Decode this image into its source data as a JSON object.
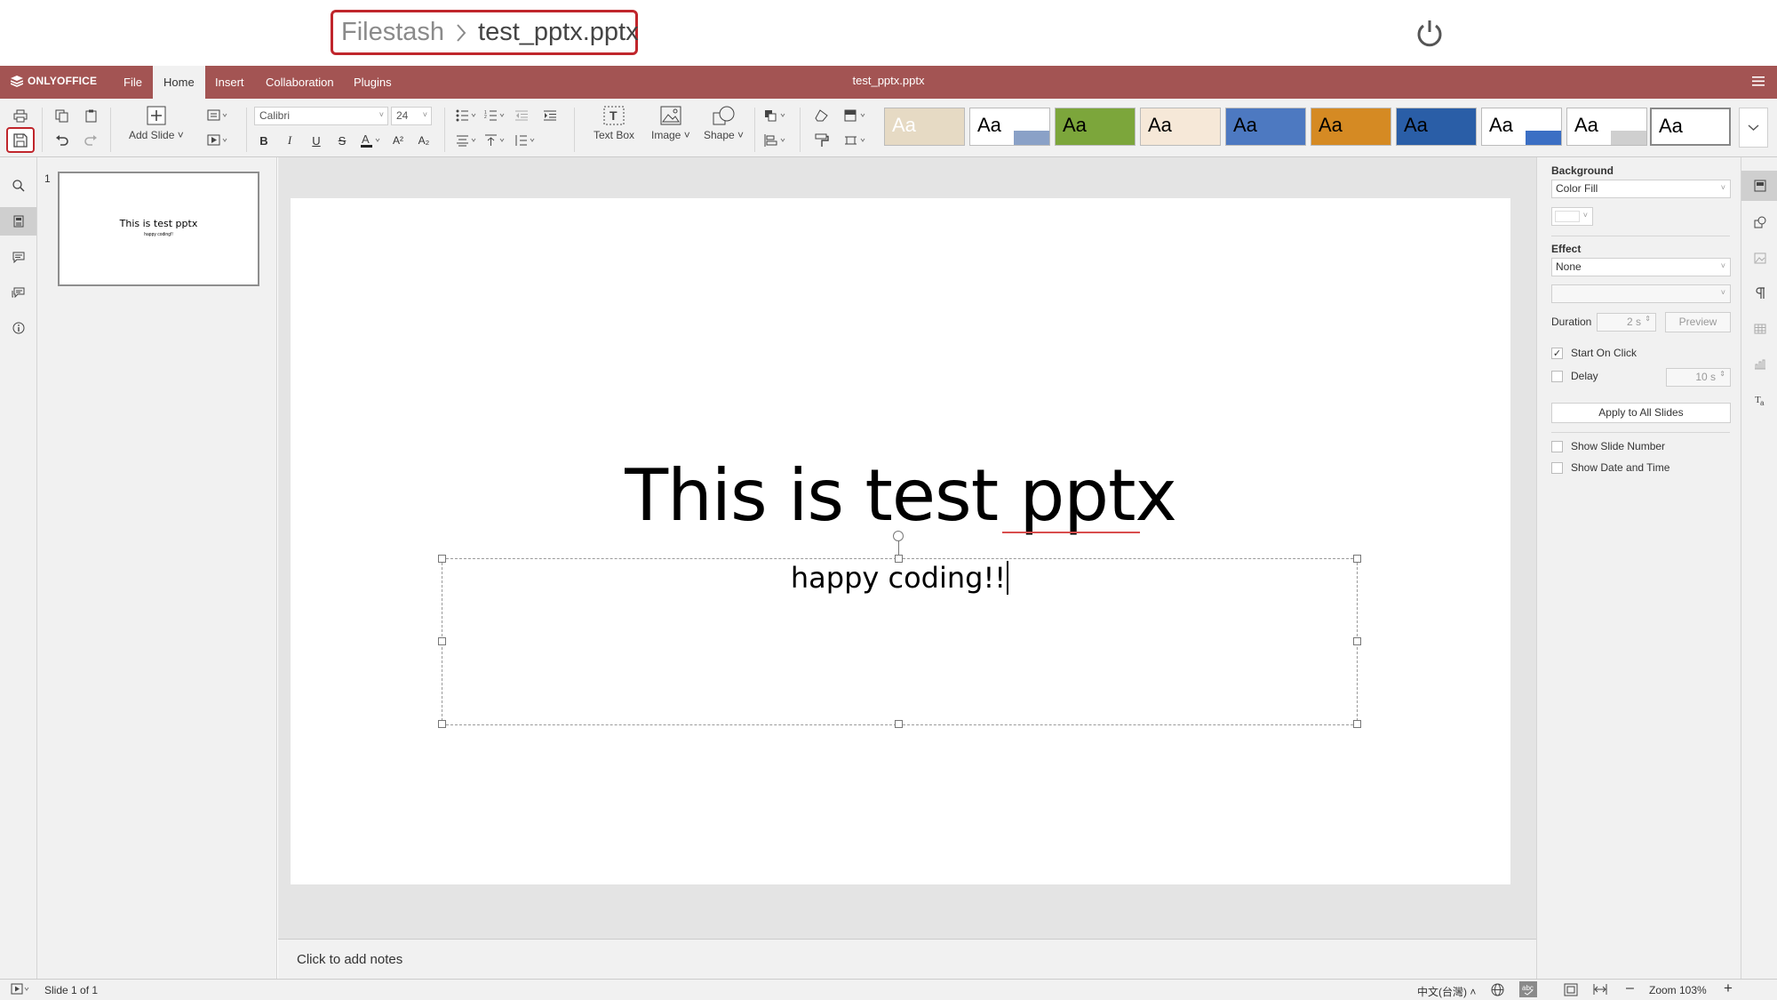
{
  "breadcrumb": {
    "root": "Filestash",
    "file": "test_pptx.pptx"
  },
  "header": {
    "logo": "ONLYOFFICE",
    "doc_title": "test_pptx.pptx",
    "tabs": [
      {
        "label": "File"
      },
      {
        "label": "Home",
        "active": true
      },
      {
        "label": "Insert"
      },
      {
        "label": "Collaboration"
      },
      {
        "label": "Plugins"
      }
    ]
  },
  "toolbar": {
    "add_slide": "Add Slide",
    "font_name": "Calibri",
    "font_size": "24",
    "text_box": "Text Box",
    "image": "Image",
    "shape": "Shape",
    "themes": [
      {
        "name": "theme-1",
        "bg": "#e6dac4",
        "fg": "#fff"
      },
      {
        "name": "theme-2",
        "bg": "#ffffff",
        "accent": "#8aa1c7",
        "fg": "#000"
      },
      {
        "name": "theme-3",
        "bg": "#7ca63b",
        "fg": "#000"
      },
      {
        "name": "theme-4",
        "bg": "#f6e8d8",
        "fg": "#000"
      },
      {
        "name": "theme-5",
        "bg": "#4d79c1",
        "fg": "#000"
      },
      {
        "name": "theme-6",
        "bg": "#d58a23",
        "fg": "#000"
      },
      {
        "name": "theme-7",
        "bg": "#2a5ea7",
        "fg": "#000"
      },
      {
        "name": "theme-8",
        "bg": "#ffffff",
        "accent": "#3b6fc4",
        "fg": "#000"
      },
      {
        "name": "theme-9",
        "bg": "#ffffff",
        "accent": "#cfcfcf",
        "fg": "#000"
      },
      {
        "name": "theme-10",
        "bg": "#ffffff",
        "fg": "#000",
        "selected": true
      }
    ]
  },
  "slides_panel": {
    "number": "1",
    "thumb_title": "This is test pptx",
    "thumb_sub": "happy coding!!"
  },
  "slide": {
    "title": "This is test pptx",
    "subtitle": "happy coding!!"
  },
  "notes": {
    "placeholder": "Click to add notes"
  },
  "right_panel": {
    "background_label": "Background",
    "background_value": "Color Fill",
    "effect_label": "Effect",
    "effect_value": "None",
    "duration_label": "Duration",
    "duration_value": "2 s",
    "preview": "Preview",
    "start_on_click": "Start On Click",
    "start_on_click_checked": true,
    "delay_label": "Delay",
    "delay_value": "10 s",
    "apply_all": "Apply to All Slides",
    "show_slide_number": "Show Slide Number",
    "show_date_time": "Show Date and Time"
  },
  "status": {
    "slide_counter": "Slide 1 of 1",
    "language": "中文(台灣)",
    "zoom": "Zoom 103%"
  },
  "colors": {
    "header": "#a35453",
    "accent_red": "#c0262c",
    "toolbar": "#f1f1f1"
  }
}
